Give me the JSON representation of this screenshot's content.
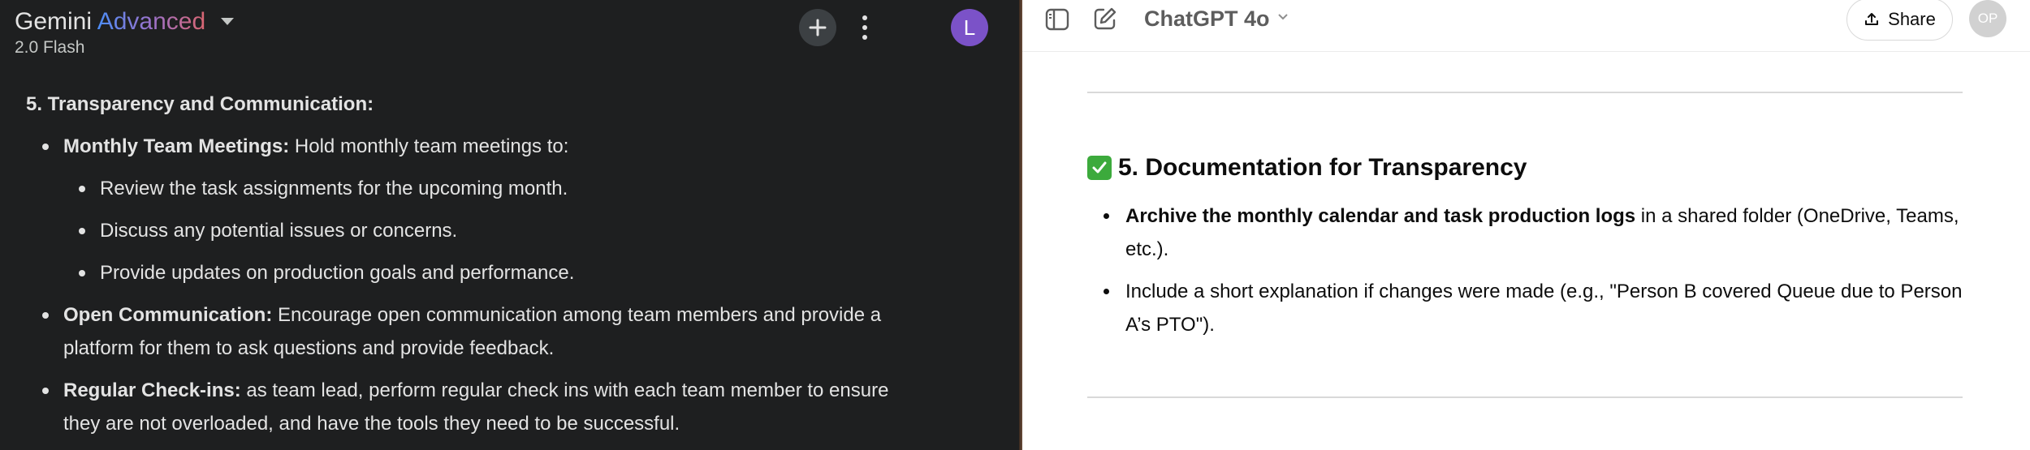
{
  "gemini": {
    "app_name": "Gemini",
    "tier": "Advanced",
    "model": "2.0 Flash",
    "avatar_initial": "L",
    "icons": {
      "dropdown": "caret-down-icon",
      "new_chat": "plus-icon",
      "more": "kebab-menu-icon"
    },
    "heading": "5. Transparency and Communication:",
    "items": [
      {
        "bold": "Monthly Team Meetings:",
        "text": " Hold monthly team meetings to:",
        "subitems": [
          "Review the task assignments for the upcoming month.",
          "Discuss any potential issues or concerns.",
          "Provide updates on production goals and performance."
        ]
      },
      {
        "bold": "Open Communication:",
        "text": " Encourage open communication among team members and provide a platform for them to ask questions and provide feedback."
      },
      {
        "bold": "Regular Check-ins:",
        "text": " as team lead, perform regular check ins with each team member to ensure they are not overloaded, and have the tools they need to be successful."
      }
    ],
    "colors": {
      "background": "#1e1f20",
      "text": "#e3e3e3",
      "avatar": "#7b52c8"
    }
  },
  "chatgpt": {
    "model": "ChatGPT 4o",
    "share_label": "Share",
    "avatar_initials": "OP",
    "icons": {
      "sidebar": "sidebar-toggle-icon",
      "new_chat": "edit-icon",
      "share": "upload-icon",
      "checkmark": "check-box-icon"
    },
    "heading": "5. Documentation for Transparency",
    "items": [
      {
        "bold": "Archive the monthly calendar and task production logs",
        "text": " in a shared folder (OneDrive, Teams, etc.)."
      },
      {
        "bold": "",
        "text": "Include a short explanation if changes were made (e.g., \"Person B covered Queue due to Person A’s PTO\")."
      }
    ],
    "colors": {
      "check": "#3caa3c",
      "text": "#0d0d0d"
    }
  }
}
